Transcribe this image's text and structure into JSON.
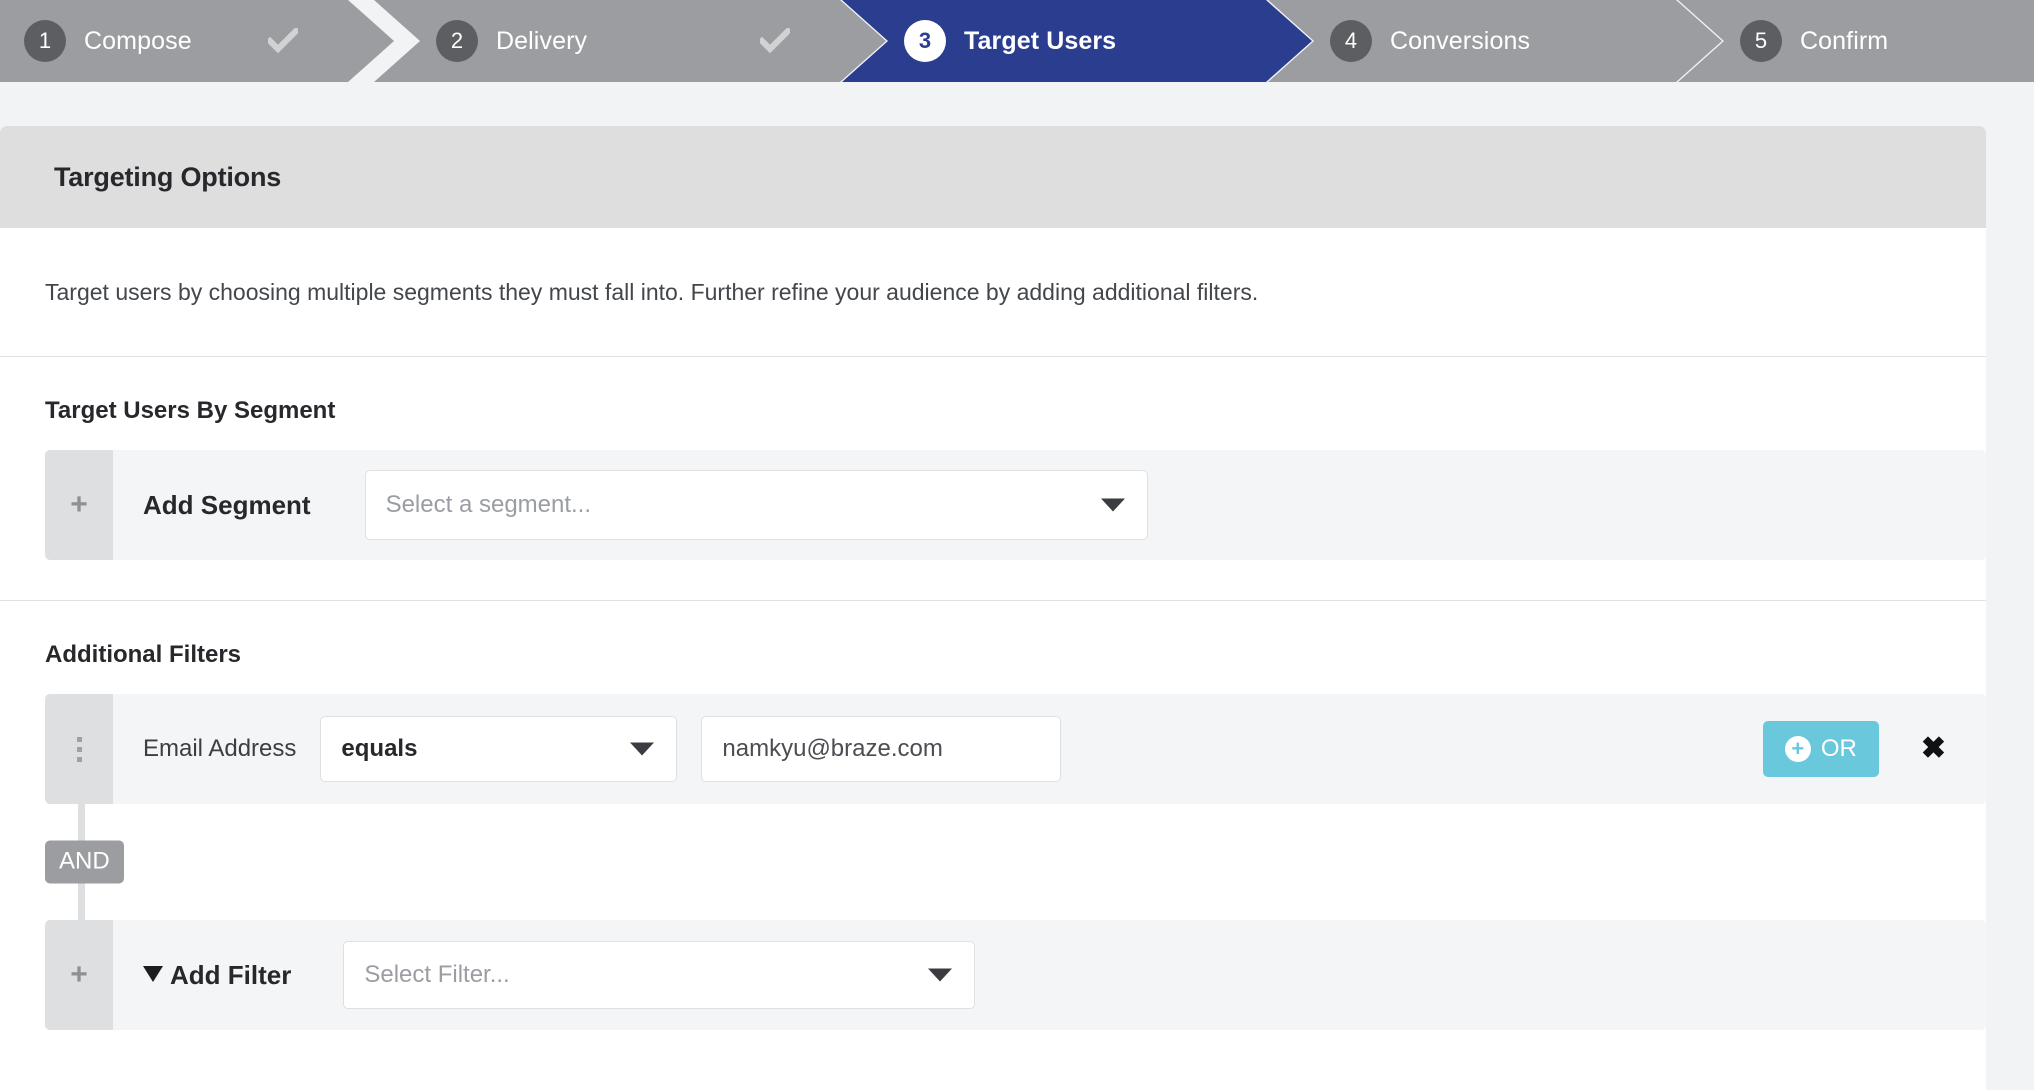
{
  "wizard": {
    "steps": [
      {
        "num": "1",
        "label": "Compose",
        "state": "complete",
        "check": "check-icon"
      },
      {
        "num": "2",
        "label": "Delivery",
        "state": "complete",
        "check": "check-icon"
      },
      {
        "num": "3",
        "label": "Target Users",
        "state": "active",
        "check": ""
      },
      {
        "num": "4",
        "label": "Conversions",
        "state": "upcoming",
        "check": ""
      },
      {
        "num": "5",
        "label": "Confirm",
        "state": "upcoming",
        "check": ""
      }
    ],
    "colors": {
      "active": "#2a3d8f",
      "inactive": "#9b9da1",
      "num_circle": "#5c5e62"
    }
  },
  "panel": {
    "header_title": "Targeting Options",
    "description": "Target users by choosing multiple segments they must fall into. Further refine your audience by adding additional filters."
  },
  "segment_section": {
    "title": "Target Users By Segment",
    "add_label": "Add Segment",
    "add_icon": "plus-icon",
    "select_placeholder": "Select a segment...",
    "caret_icon": "caret-down-icon"
  },
  "filters_section": {
    "title": "Additional Filters",
    "rows": [
      {
        "grip_icon": "drag-handle-icon",
        "attribute": "Email Address",
        "operator": "equals",
        "operator_caret": "caret-down-icon",
        "value": "namkyu@braze.com",
        "or_label": "OR",
        "or_icon": "circle-plus-icon",
        "remove_icon": "close-icon"
      }
    ],
    "connector_label": "AND",
    "add_label": "Add Filter",
    "add_icon": "funnel-icon",
    "add_plus_icon": "plus-icon",
    "select_placeholder": "Select Filter...",
    "caret_icon": "caret-down-icon",
    "or_color": "#69c8dc",
    "and_color": "#9b9da1"
  }
}
